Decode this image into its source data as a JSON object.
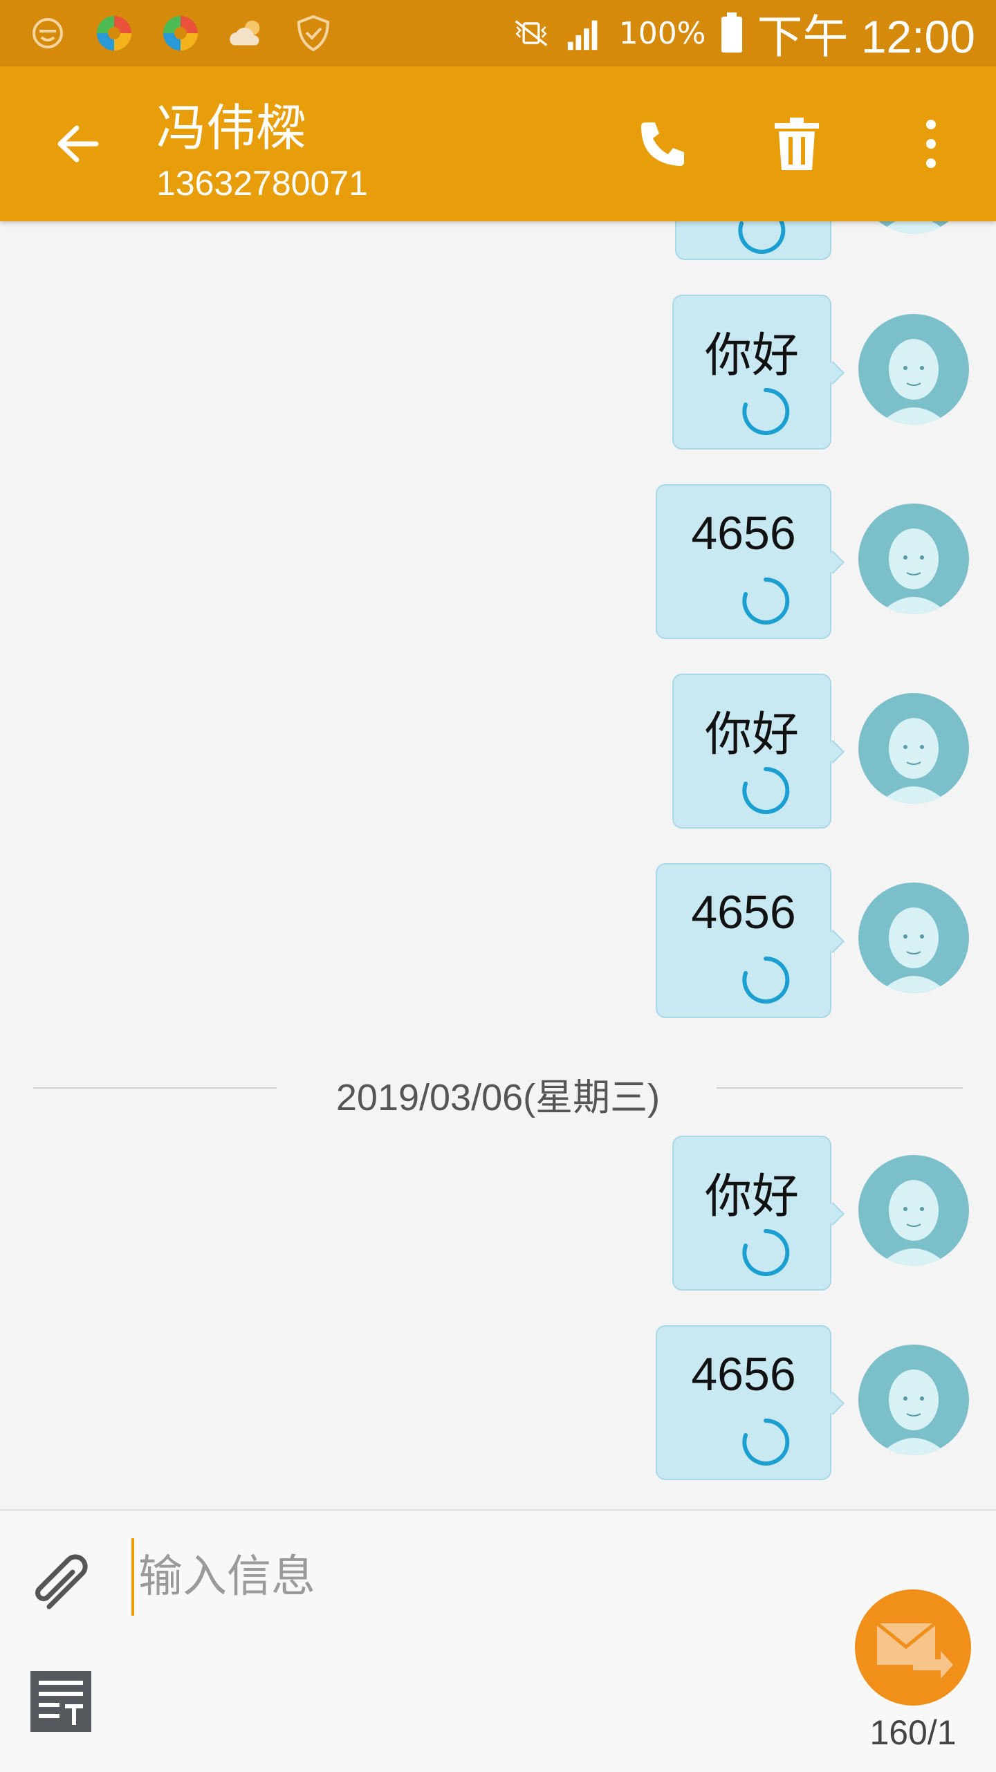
{
  "status_bar": {
    "battery": "100%",
    "time": "下午 12:00",
    "left_icons": [
      "emoji-face-icon",
      "app-circle-icon",
      "app-circle-icon",
      "cloud-weather-icon",
      "shield-check-icon"
    ],
    "right_icons": [
      "vibrate-muted-icon",
      "signal-bars-icon",
      "battery-icon"
    ]
  },
  "header": {
    "contact_name": "冯伟樑",
    "contact_number": "13632780071",
    "actions": [
      "phone-icon",
      "trash-icon",
      "more-vert-icon"
    ]
  },
  "messages": [
    {
      "text": "",
      "status": "sending"
    },
    {
      "text": "你好",
      "status": "sending"
    },
    {
      "text": "4656",
      "status": "sending"
    },
    {
      "text": "你好",
      "status": "sending"
    },
    {
      "text": "4656",
      "status": "sending"
    },
    {
      "text": "你好",
      "status": "sending"
    },
    {
      "text": "4656",
      "status": "sending"
    }
  ],
  "date_separator": "2019/03/06(星期三)",
  "composer": {
    "placeholder": "输入信息",
    "value": "",
    "char_count": "160/1"
  },
  "colors": {
    "status_bar": "#d68a0c",
    "app_bar": "#e89d0b",
    "bubble": "#c8e8f2",
    "avatar": "#7bbfcb",
    "send_button": "#f0901a",
    "spinner": "#1a9fd0"
  }
}
